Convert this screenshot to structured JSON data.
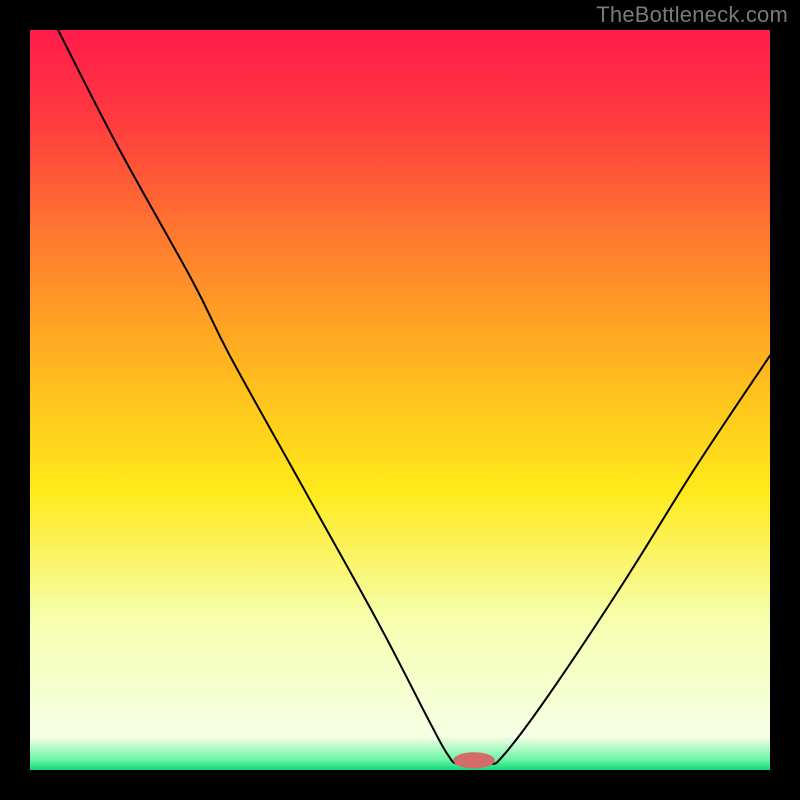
{
  "watermark": "TheBottleneck.com",
  "chart_data": {
    "type": "line",
    "title": "",
    "xlabel": "",
    "ylabel": "",
    "xlim": [
      0,
      100
    ],
    "ylim": [
      0,
      100
    ],
    "background_gradient": {
      "stops": [
        {
          "offset": 0.0,
          "color": "#ff1b4b"
        },
        {
          "offset": 0.12,
          "color": "#ff3a3f"
        },
        {
          "offset": 0.28,
          "color": "#ff7a2f"
        },
        {
          "offset": 0.45,
          "color": "#ffb51f"
        },
        {
          "offset": 0.62,
          "color": "#ffe91a"
        },
        {
          "offset": 0.8,
          "color": "#f6ffb0"
        },
        {
          "offset": 0.955,
          "color": "#f6ffe4"
        },
        {
          "offset": 0.986,
          "color": "#6cf3a6"
        },
        {
          "offset": 1.0,
          "color": "#12d879"
        }
      ]
    },
    "series": [
      {
        "name": "bottleneck-curve",
        "color": "#000000",
        "stroke_width": 2,
        "points": [
          {
            "x": 3.8,
            "y": 100.0
          },
          {
            "x": 12.0,
            "y": 84.0
          },
          {
            "x": 22.0,
            "y": 66.0
          },
          {
            "x": 27.0,
            "y": 56.0
          },
          {
            "x": 37.0,
            "y": 38.0
          },
          {
            "x": 47.0,
            "y": 20.0
          },
          {
            "x": 54.0,
            "y": 6.5
          },
          {
            "x": 56.5,
            "y": 2.0
          },
          {
            "x": 58.0,
            "y": 0.8
          },
          {
            "x": 62.0,
            "y": 0.8
          },
          {
            "x": 64.0,
            "y": 2.0
          },
          {
            "x": 70.0,
            "y": 10.0
          },
          {
            "x": 80.0,
            "y": 25.0
          },
          {
            "x": 90.0,
            "y": 41.0
          },
          {
            "x": 100.0,
            "y": 56.0
          }
        ]
      }
    ],
    "marker": {
      "name": "optimal-point",
      "shape": "pill",
      "color": "#d46a6a",
      "cx": 60.0,
      "cy": 1.3,
      "rx": 2.8,
      "ry": 1.1
    }
  }
}
